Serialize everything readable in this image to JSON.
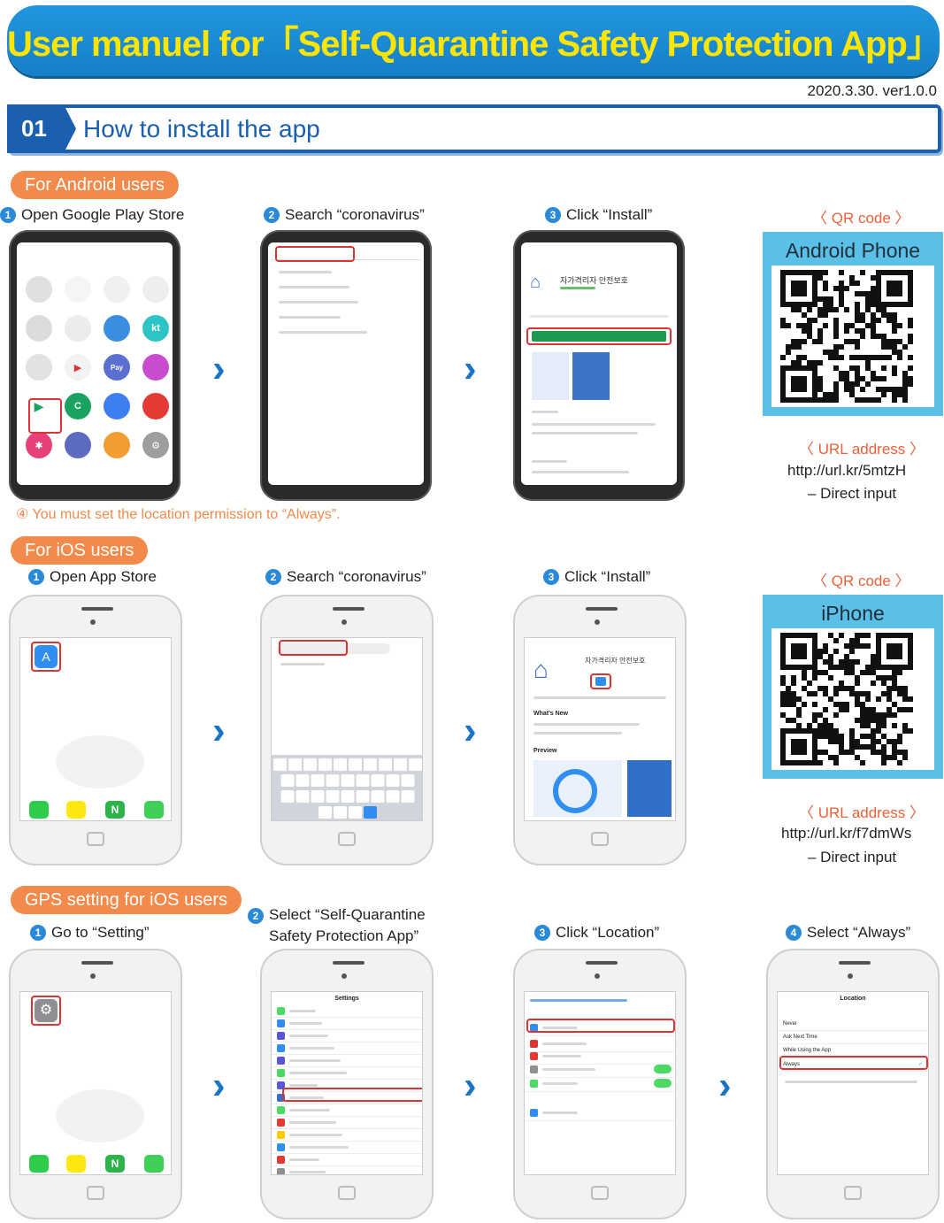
{
  "title": "User manuel for「Self-Quarantine Safety Protection App」",
  "version": "2020.3.30. ver1.0.0",
  "section": {
    "number": "01",
    "title": "How to install the app"
  },
  "android": {
    "pill": "For Android users",
    "steps": [
      {
        "num": "1",
        "label": "Open Google Play Store"
      },
      {
        "num": "2",
        "label": "Search “coronavirus”"
      },
      {
        "num": "3",
        "label": "Click “Install”"
      }
    ],
    "warning": "④ You must set the location permission to “Always”.",
    "qr_label": "〈 QR code 〉",
    "qr_caption": "Android Phone",
    "url_label": "〈 URL address 〉",
    "url": "http://url.kr/5mtzH",
    "url_note": "– Direct input",
    "phone": {
      "app_title": "자가격리자 안전보호"
    }
  },
  "ios": {
    "pill": "For iOS users",
    "steps": [
      {
        "num": "1",
        "label": "Open App Store"
      },
      {
        "num": "2",
        "label": "Search “coronavirus”"
      },
      {
        "num": "3",
        "label": "Click “Install”"
      }
    ],
    "qr_label": "〈 QR code 〉",
    "qr_caption": "iPhone",
    "url_label": "〈 URL address 〉",
    "url": "http://url.kr/f7dmWs",
    "url_note": "– Direct input",
    "phone": {
      "whats_new": "What's New",
      "preview": "Preview",
      "app_title": "자가격리자 안전보호"
    }
  },
  "gps": {
    "pill": "GPS setting for iOS users",
    "steps": [
      {
        "num": "1",
        "label": "Go to “Setting”"
      },
      {
        "num": "2",
        "label": "Select “Self-Quarantine Safety Protection App”"
      },
      {
        "num": "3",
        "label": "Click “Location”"
      },
      {
        "num": "4",
        "label": "Select “Always”"
      }
    ],
    "phone": {
      "settings_title": "Settings",
      "location_title": "Location",
      "options": [
        "Never",
        "Ask Next Time",
        "While Using the App",
        "Always"
      ]
    }
  },
  "colors": {
    "banner_blue": "#1a88d4",
    "title_yellow": "#ffe600",
    "pill_orange": "#f3894a",
    "section_blue": "#1a5fb0",
    "qr_card_blue": "#5bc0e8",
    "highlight_red": "#dd3333"
  }
}
